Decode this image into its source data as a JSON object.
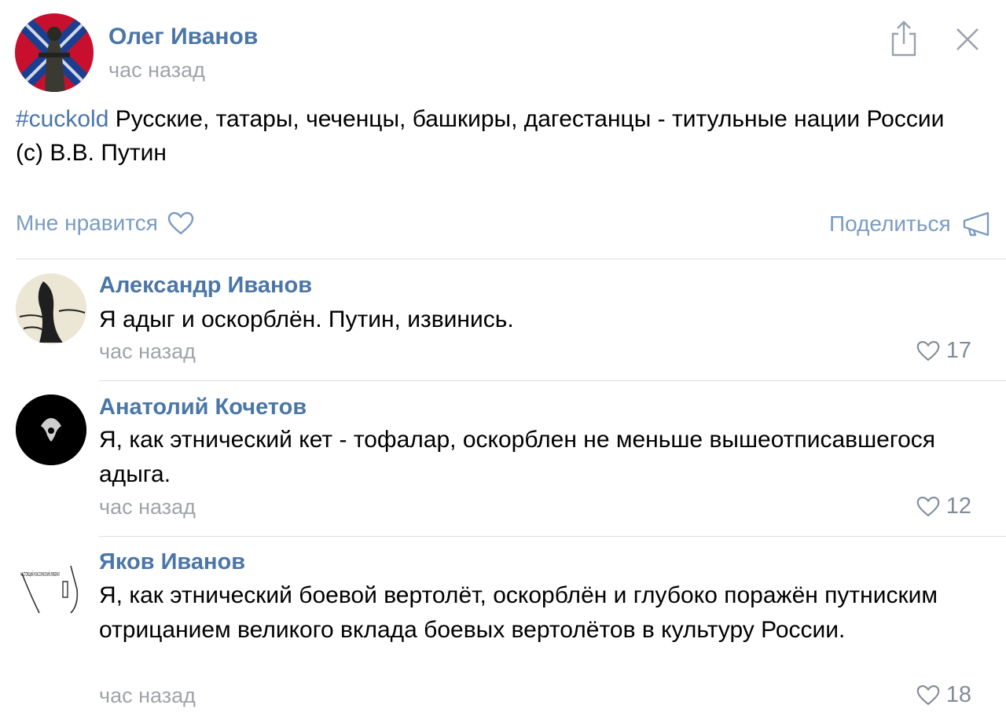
{
  "post": {
    "author": "Олег Иванов",
    "time": "час назад",
    "hashtag": "#cuckold",
    "text": " Русские, татары, чеченцы, башкиры, дагестанцы - титульные нации России (с) В.В. Путин",
    "like_label": "Мне нравится",
    "share_label": "Поделиться"
  },
  "comments": [
    {
      "author": "Александр Иванов",
      "text": "Я адыг и оскорблён. Путин, извинись.",
      "time": "час назад",
      "likes": "17"
    },
    {
      "author": "Анатолий Кочетов",
      "text": "Я, как этнический кет - тофалар, оскорблен не меньше вышеотписавшегося адыга.",
      "time": "час назад",
      "likes": "12"
    },
    {
      "author": "Яков Иванов",
      "text": "Я, как этнический боевой вертолёт, оскорблён и глубоко поражён путниским отрицанием великого вклада боевых вертолётов в культуру России.",
      "time": "час назад",
      "likes": "18"
    }
  ],
  "avatar3_caption": "НАСТОЯЩИЙ КЛАССИЧЕСКИЙ ЛИБЕРАЛ",
  "colors": {
    "link": "#4a76a8",
    "muted": "#a0a4a9",
    "action": "#7a9cc2",
    "divider": "#dcdfe3"
  }
}
